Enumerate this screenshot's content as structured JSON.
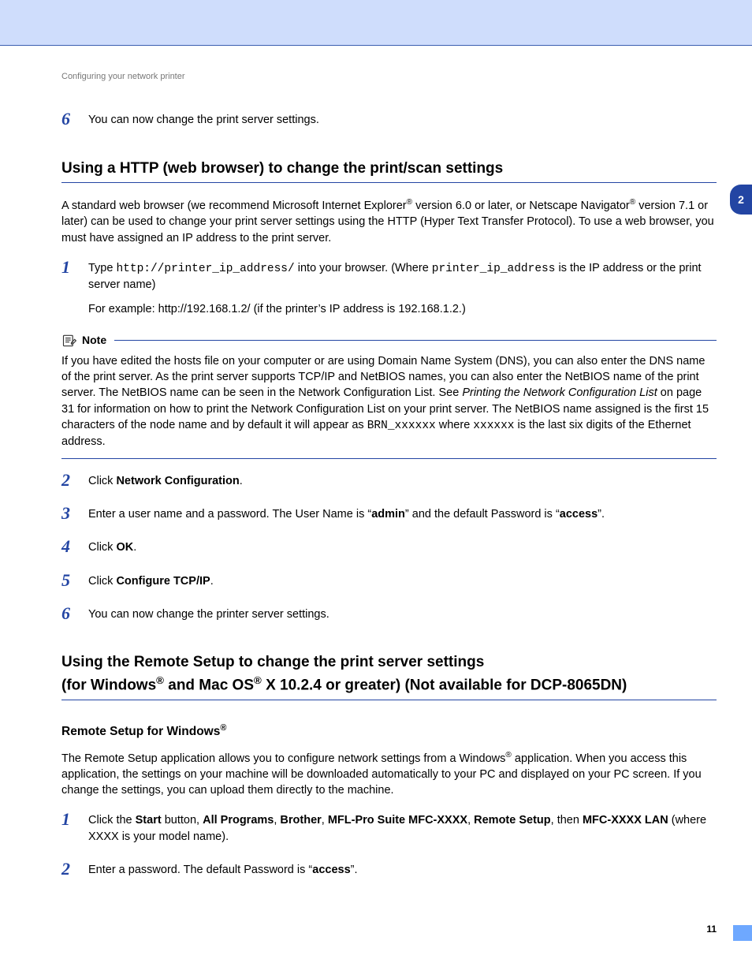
{
  "meta": {
    "header": "Configuring your network printer",
    "chapter": "2",
    "page_number": "11"
  },
  "top_step": {
    "num": "6",
    "text": "You can now change the print server settings."
  },
  "section1": {
    "title": "Using a HTTP (web browser) to change the print/scan settings",
    "intro": {
      "part1": "A standard web browser (we recommend Microsoft Internet Explorer",
      "sup1": "®",
      "part2": " version 6.0 or later, or Netscape Navigator",
      "sup2": "®",
      "part3": " version 7.1 or later) can be used to change your print server settings using the HTTP (Hyper Text Transfer Protocol). To use a web browser, you must have assigned an IP address to the print server."
    },
    "steps": [
      {
        "num": "1",
        "p1_a": "Type ",
        "p1_code1": "http://printer_ip_address/",
        "p1_b": " into your browser. (Where ",
        "p1_code2": "printer_ip_address",
        "p1_c": " is the IP address or the print server name)",
        "p2": "For example: http://192.168.1.2/ (if the printer’s IP address is 192.168.1.2.)"
      },
      {
        "num": "2",
        "a": "Click ",
        "b": "Network Configuration",
        "c": "."
      },
      {
        "num": "3",
        "a": "Enter a user name and a password. The User Name is ",
        "b": "admin",
        "c": " and the default Password is ",
        "d": "access"
      },
      {
        "num": "4",
        "a": "Click ",
        "b": "OK",
        "c": "."
      },
      {
        "num": "5",
        "a": "Click ",
        "b": "Configure TCP/IP",
        "c": "."
      },
      {
        "num": "6",
        "a": "You can now change the printer server settings."
      }
    ]
  },
  "note": {
    "label": "Note",
    "body_a": "If you have edited the hosts file on your computer or are using Domain Name System (DNS), you can also enter the DNS name of the print server. As the print server supports TCP/IP and NetBIOS names, you can also enter the NetBIOS name of the print server. The NetBIOS name can be seen in the Network Configuration List. See ",
    "body_link": "Printing the Network Configuration List",
    "body_b": " on page 31 for information on how to print the Network Configuration List on your print server. The NetBIOS name assigned is the first 15 characters of the node name and by default it will appear as ",
    "code1": "BRN_xxxxxx",
    "body_c": " where ",
    "code2": "xxxxxx",
    "body_d": " is the last six digits of the Ethernet address."
  },
  "section2": {
    "title_line1a": "Using the Remote Setup to change the print server settings",
    "title_line2a": "(for Windows",
    "sup1": "®",
    "title_line2b": " and Mac OS",
    "sup2": "®",
    "title_line2c": " X 10.2.4 or greater) (Not available for DCP-8065DN)",
    "subhead_a": "Remote Setup for Windows",
    "subhead_sup": "®",
    "intro_a": "The Remote Setup application allows you to configure network settings from a Windows",
    "intro_sup": "®",
    "intro_b": " application. When you access this application, the settings on your machine will be downloaded automatically to your PC and displayed on your PC screen. If you change the settings, you can upload them directly to the machine.",
    "steps": [
      {
        "num": "1",
        "a": "Click the ",
        "b1": "Start",
        "c1": " button, ",
        "b2": "All Programs",
        "b3": "Brother",
        "b4": "MFL-Pro Suite MFC-XXXX",
        "b5": "Remote Setup",
        "c2": ", then ",
        "b6": "MFC-XXXX LAN",
        "c3": " (where XXXX is your model name).",
        "sep": ", "
      },
      {
        "num": "2",
        "a": "Enter a password. The default Password is ",
        "b": "access"
      }
    ]
  }
}
